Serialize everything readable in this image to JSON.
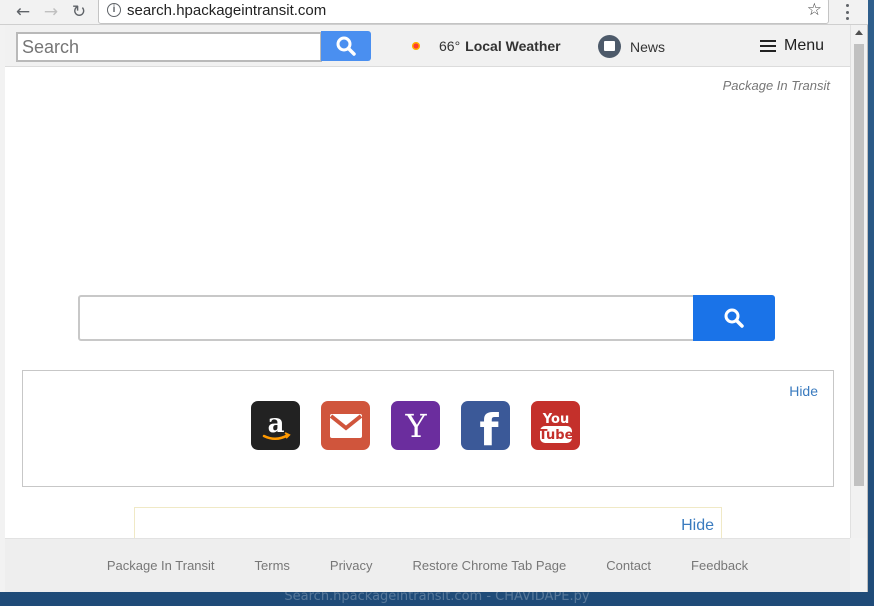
{
  "browser": {
    "url": "search.hpackageintransit.com",
    "back_icon": "←",
    "forward_icon": "→",
    "reload_icon": "↻",
    "star_icon": "☆"
  },
  "topbar": {
    "search_placeholder": "Search",
    "weather_temp": "66°",
    "weather_label": "Local Weather",
    "news_label": "News",
    "menu_label": "Menu"
  },
  "brand": "Package In Transit",
  "tiles_box": {
    "hide_label": "Hide",
    "tiles": [
      "amazon",
      "gmail",
      "yahoo",
      "facebook",
      "youtube"
    ]
  },
  "second_box": {
    "hide_label": "Hide"
  },
  "footer": {
    "links": [
      "Package In Transit",
      "Terms",
      "Privacy",
      "Restore Chrome Tab Page",
      "Contact",
      "Feedback"
    ]
  },
  "wallpaper_caption": "Search.hpackageintransit.com - CHAVIDAPE.py",
  "colors": {
    "search_button": "#1a73e8",
    "top_search_button": "#4a8ff0",
    "link": "#3a7bbf",
    "amazon": "#222222",
    "gmail": "#d0553c",
    "yahoo": "#6b2d9e",
    "facebook": "#3b5998",
    "youtube": "#c4302b"
  }
}
